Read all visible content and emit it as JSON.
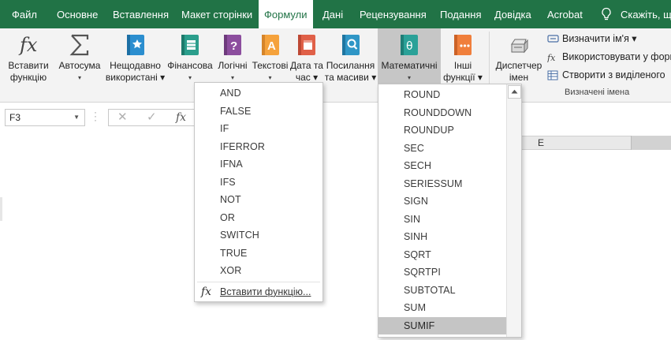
{
  "tabs": [
    {
      "label": "Файл",
      "active": false
    },
    {
      "label": "Основне",
      "active": false
    },
    {
      "label": "Вставлення",
      "active": false
    },
    {
      "label": "Макет сторінки",
      "active": false
    },
    {
      "label": "Формули",
      "active": true
    },
    {
      "label": "Дані",
      "active": false
    },
    {
      "label": "Рецензування",
      "active": false
    },
    {
      "label": "Подання",
      "active": false
    },
    {
      "label": "Довідка",
      "active": false
    },
    {
      "label": "Acrobat",
      "active": false
    },
    {
      "label": "Скажіть, що",
      "active": false
    }
  ],
  "ribbon": {
    "insert_function": {
      "line1": "Вставити",
      "line2": "функцію"
    },
    "autosum": {
      "line1": "Автосума",
      "line2": "▾"
    },
    "recent": {
      "line1": "Нещодавно",
      "line2": "використані ▾"
    },
    "financial": {
      "line1": "Фінансова",
      "line2": "▾"
    },
    "logical": {
      "line1": "Логічні",
      "line2": "▾"
    },
    "text": {
      "line1": "Текстові",
      "line2": "▾"
    },
    "datetime": {
      "line1": "Дата та",
      "line2": "час ▾"
    },
    "lookup": {
      "line1": "Посилання",
      "line2": "та масиви ▾"
    },
    "math": {
      "line1": "Математичні",
      "line2": "▾"
    },
    "more": {
      "line1": "Інші",
      "line2": "функції ▾"
    },
    "name_manager": {
      "line1": "Диспетчер",
      "line2": "імен"
    },
    "define_name": "Визначити ім'я ▾",
    "use_in_formula": "Використовувати у форм",
    "create_from_selection": "Створити з виділеного",
    "defined_names_group": "Визначені імена"
  },
  "formula_bar": {
    "name_box": "F3",
    "cancel_glyph": "✕",
    "enter_glyph": "✓",
    "fx_glyph": "fx"
  },
  "sheet": {
    "column_label": "E"
  },
  "logical_menu": {
    "items": [
      "AND",
      "FALSE",
      "IF",
      "IFERROR",
      "IFNA",
      "IFS",
      "NOT",
      "OR",
      "SWITCH",
      "TRUE",
      "XOR"
    ],
    "insert_function": "Вставити функцію..."
  },
  "math_menu": {
    "items": [
      "ROUND",
      "ROUNDDOWN",
      "ROUNDUP",
      "SEC",
      "SECH",
      "SERIESSUM",
      "SIGN",
      "SIN",
      "SINH",
      "SQRT",
      "SQRTPI",
      "SUBTOTAL",
      "SUM",
      "SUMIF"
    ],
    "highlighted": "SUMIF"
  },
  "colors": {
    "tab_bar": "#217346",
    "ribbon_bg": "#f3f3f3",
    "financial_icon": "#2b9e8c",
    "logical_icon": "#8c4e9e",
    "text_icon": "#f5a23c",
    "datetime_icon": "#e06048",
    "lookup_icon": "#2f96c6",
    "math_icon": "#2aa198",
    "more_icon": "#f07f3c",
    "highlight": "#c5c5c5"
  }
}
